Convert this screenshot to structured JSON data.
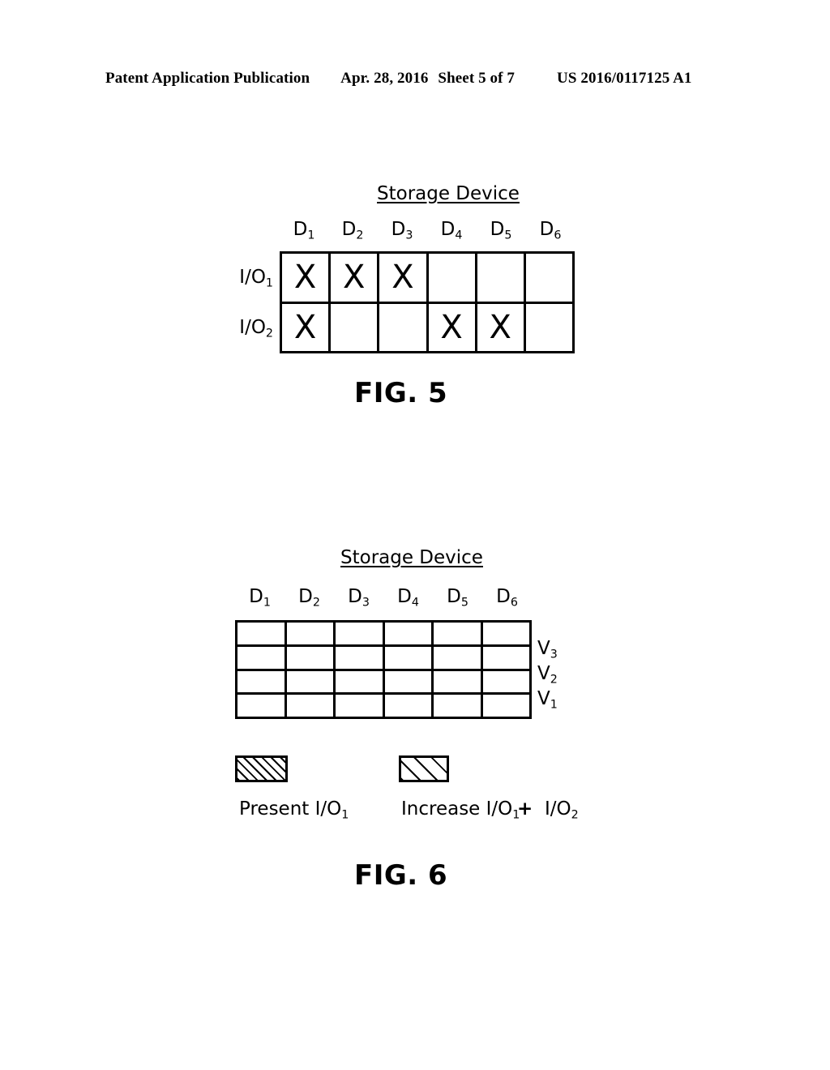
{
  "header": {
    "publication": "Patent Application Publication",
    "date": "Apr. 28, 2016",
    "sheet": "Sheet 5 of 7",
    "patent_number": "US 2016/0117125 A1"
  },
  "figures": [
    {
      "id": "fig5",
      "title": "Storage Device",
      "caption": "FIG. 5",
      "column_headers": [
        "D1",
        "D2",
        "D3",
        "D4",
        "D5",
        "D6"
      ],
      "column_headers_base": [
        "D",
        "D",
        "D",
        "D",
        "D",
        "D"
      ],
      "column_headers_sub": [
        "1",
        "2",
        "3",
        "4",
        "5",
        "6"
      ],
      "row_headers_base": [
        "I/O",
        "I/O"
      ],
      "row_headers_sub": [
        "1",
        "2"
      ],
      "mark": "X",
      "rows": [
        {
          "label": "I/O1",
          "cells": [
            "X",
            "X",
            "X",
            "",
            "",
            ""
          ]
        },
        {
          "label": "I/O2",
          "cells": [
            "X",
            "",
            "",
            "X",
            "X",
            ""
          ]
        }
      ]
    },
    {
      "id": "fig6",
      "title": "Storage Device",
      "caption": "FIG. 6",
      "column_headers_base": [
        "D",
        "D",
        "D",
        "D",
        "D",
        "D"
      ],
      "column_headers_sub": [
        "1",
        "2",
        "3",
        "4",
        "5",
        "6"
      ],
      "row_labels_base": [
        "V",
        "V",
        "V"
      ],
      "row_labels_sub": [
        "3",
        "2",
        "1"
      ],
      "rows": [
        {
          "fills": [
            "none",
            "none",
            "none",
            "none",
            "none",
            "none"
          ]
        },
        {
          "fills": [
            "none",
            "none",
            "none",
            "none",
            "none",
            "none"
          ]
        },
        {
          "fills": [
            "dense",
            "dense",
            "dense",
            "none",
            "none",
            "none"
          ]
        },
        {
          "fills": [
            "dense",
            "dense",
            "dense",
            "sparse",
            "sparse",
            "none"
          ]
        }
      ],
      "legend": [
        {
          "pattern": "dense",
          "text_base": "Present  I/O",
          "text_sub": "1"
        },
        {
          "pattern": "sparse",
          "text_base": "Increase  I/O",
          "text_sub": "1",
          "plus": "+",
          "text2_base": "I/O",
          "text2_sub": "2"
        }
      ]
    }
  ]
}
